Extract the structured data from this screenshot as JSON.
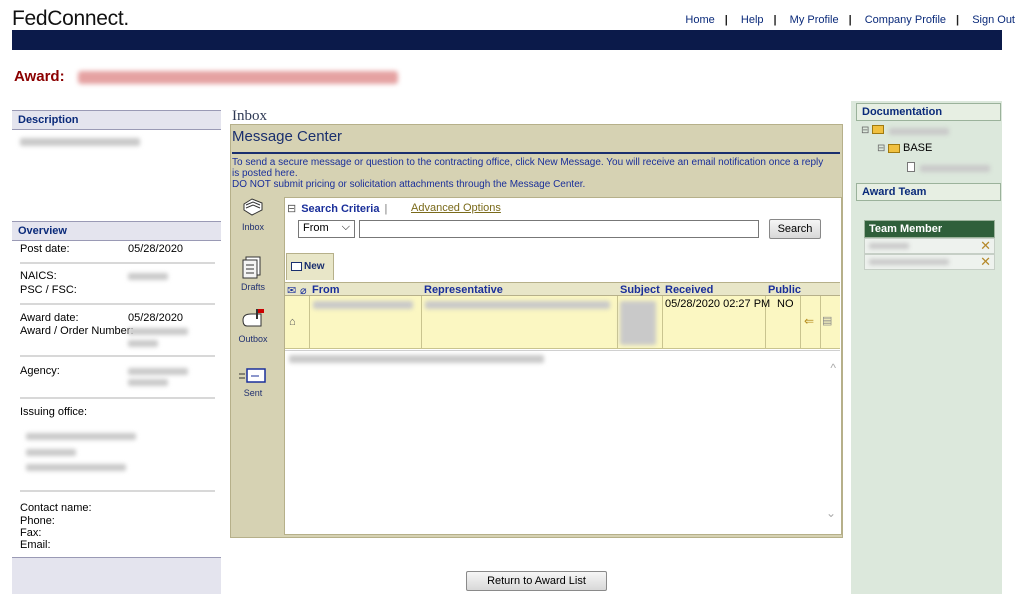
{
  "header": {
    "logo": "FedConnect.",
    "links": [
      "Home",
      "Help",
      "My Profile",
      "Company Profile",
      "Sign Out"
    ]
  },
  "award": {
    "label": "Award:"
  },
  "left": {
    "description_header": "Description",
    "overview_header": "Overview",
    "post_date_label": "Post date:",
    "post_date": "05/28/2020",
    "naics_label": "NAICS:",
    "psc_label": "PSC / FSC:",
    "award_date_label": "Award date:",
    "award_date": "05/28/2020",
    "award_number_label": "Award / Order Number:",
    "agency_label": "Agency:",
    "issuing_office_label": "Issuing office:",
    "contact_name_label": "Contact name:",
    "phone_label": "Phone:",
    "fax_label": "Fax:",
    "email_label": "Email:"
  },
  "inbox": {
    "title": "Inbox",
    "message_center_title": "Message Center",
    "info_line1": "To send a secure message or question to the contracting office, click New Message. You will receive an email notification once a reply is posted here.",
    "info_line2": "DO NOT submit pricing or solicitation attachments through the Message Center.",
    "side_nav": [
      "Inbox",
      "Drafts",
      "Outbox",
      "Sent"
    ],
    "search_criteria_label": "Search Criteria",
    "advanced_options_label": "Advanced Options",
    "search_field_selected": "From",
    "search_button": "Search",
    "new_tab": "New",
    "columns": {
      "from": "From",
      "representative": "Representative",
      "subject": "Subject",
      "received": "Received",
      "public": "Public"
    },
    "rows": [
      {
        "received": "05/28/2020 02:27 PM",
        "public": "NO"
      }
    ]
  },
  "footer": {
    "return_button": "Return to Award List"
  },
  "right": {
    "documentation_header": "Documentation",
    "base_folder": "BASE",
    "award_team_header": "Award Team",
    "team_member_header": "Team Member"
  },
  "colors": {
    "nav_bar": "#0b1a4a",
    "award_red": "#8b0000",
    "message_center_bg": "#d6d2b3",
    "selected_row": "#fbf7c2",
    "right_panel": "#dce8dc"
  }
}
